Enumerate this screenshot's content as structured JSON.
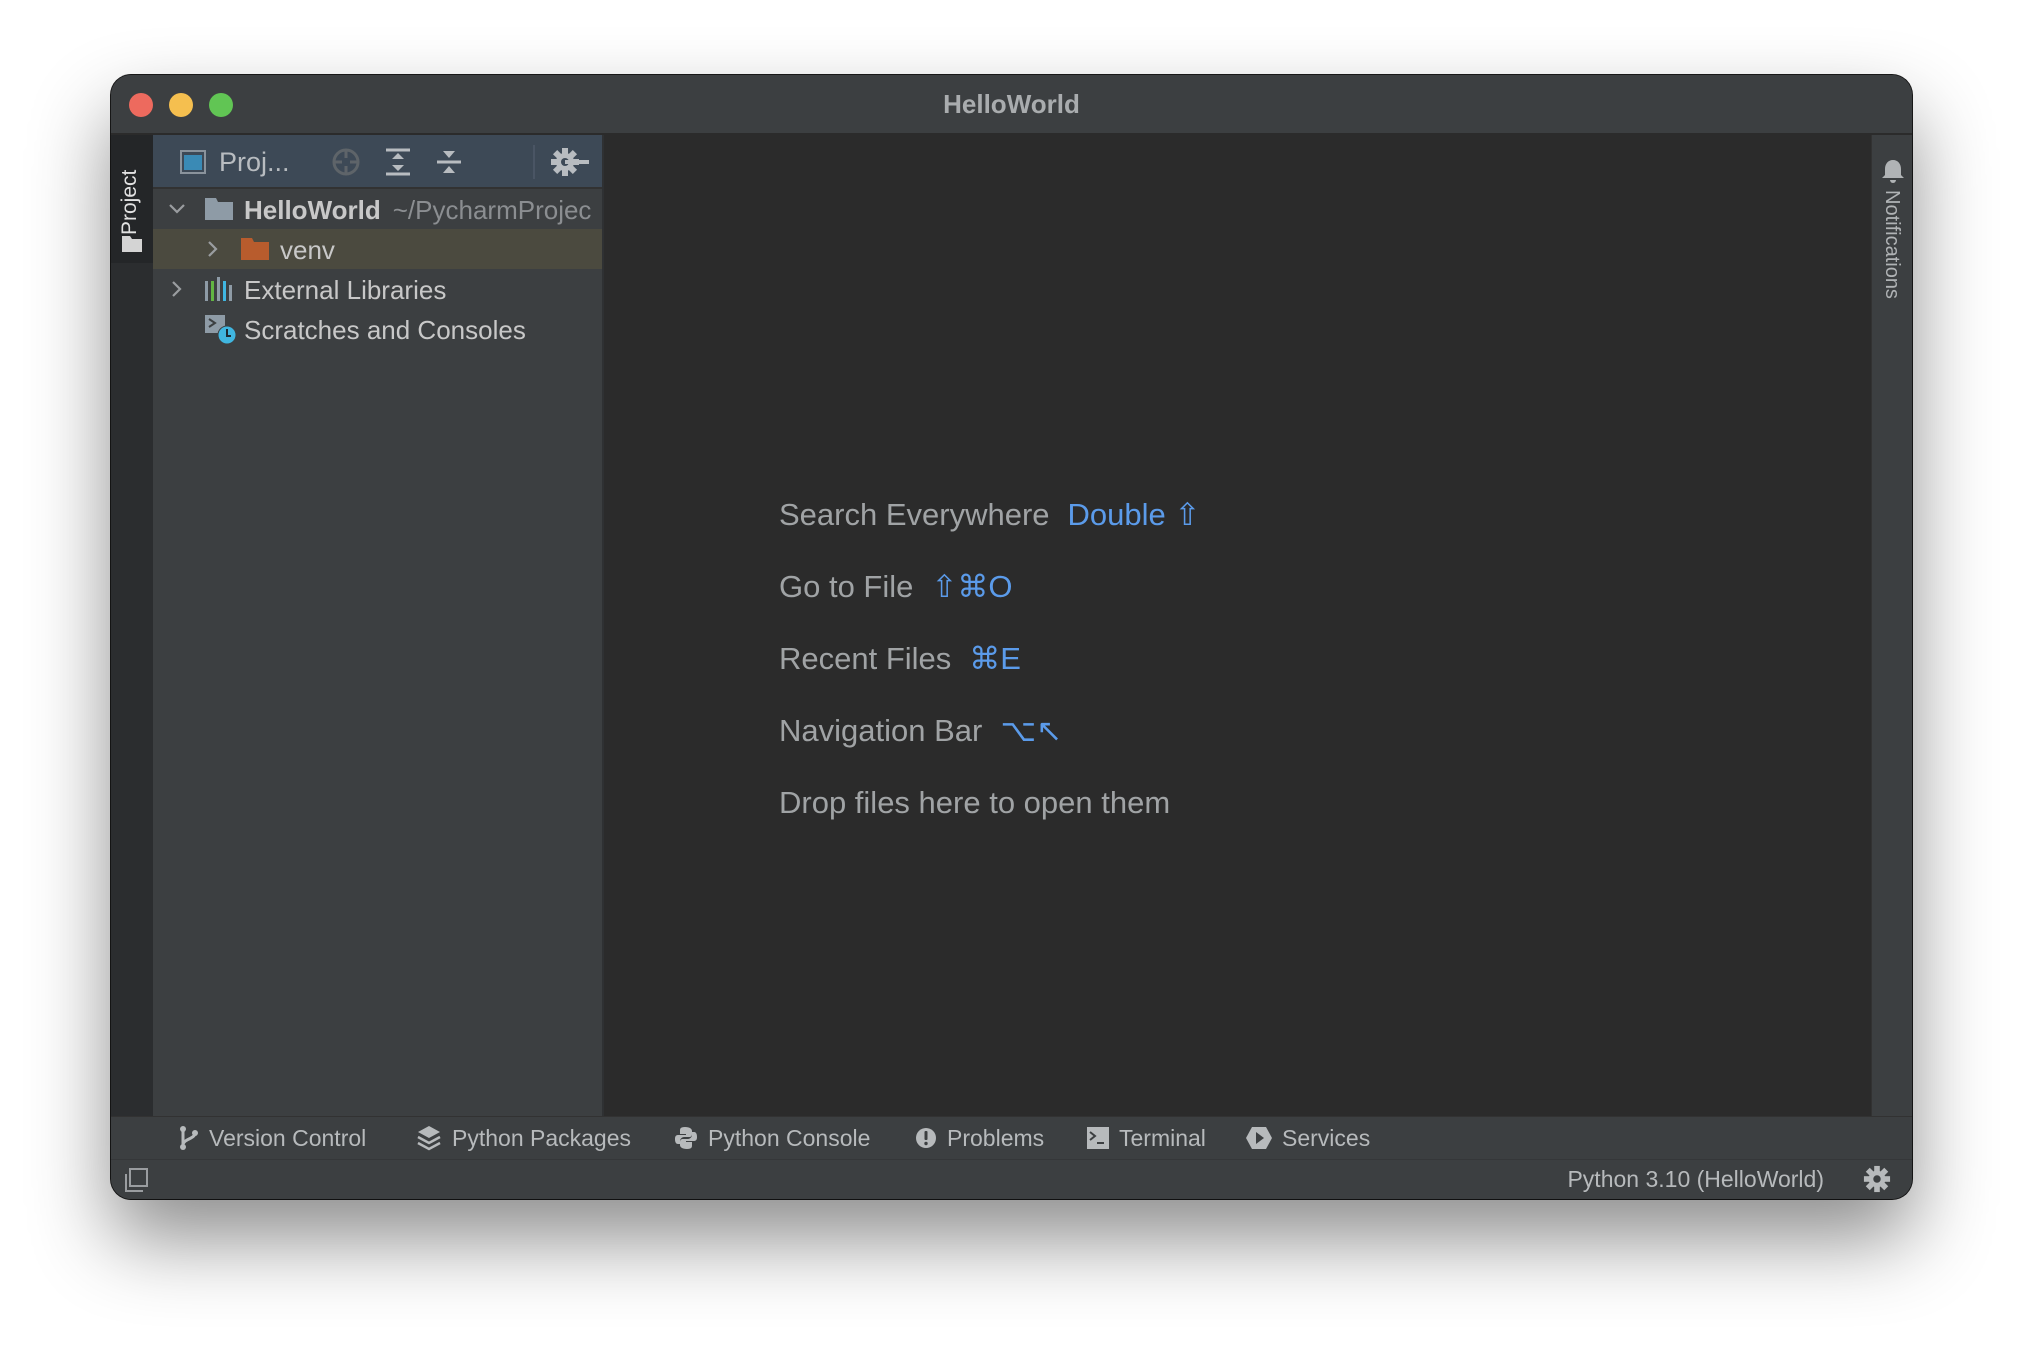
{
  "window": {
    "title": "HelloWorld",
    "traffic_lights": [
      "close",
      "minimize",
      "maximize"
    ]
  },
  "left_stripe": {
    "project_tab_label": "Project",
    "icon": "folder-icon"
  },
  "project_panel": {
    "header_title": "Proj...",
    "header_icons": [
      "project-view-icon",
      "locate-icon",
      "expand-all-icon",
      "collapse-all-icon",
      "gear-icon",
      "hide-icon"
    ],
    "tree": [
      {
        "label": "HelloWorld",
        "path": "~/PycharmProjec",
        "expanded": true,
        "icon": "folder-icon",
        "bold": true
      },
      {
        "label": "venv",
        "expanded": false,
        "icon": "excluded-folder-icon",
        "selected": true
      },
      {
        "label": "External Libraries",
        "expanded": false,
        "icon": "library-icon"
      },
      {
        "label": "Scratches and Consoles",
        "icon": "scratches-icon"
      }
    ]
  },
  "editor": {
    "hints": [
      {
        "label": "Search Everywhere",
        "shortcut": "Double ⇧"
      },
      {
        "label": "Go to File",
        "shortcut": "⇧⌘O"
      },
      {
        "label": "Recent Files",
        "shortcut": "⌘E"
      },
      {
        "label": "Navigation Bar",
        "shortcut": "⌥↖"
      },
      {
        "label": "Drop files here to open them",
        "shortcut": ""
      }
    ]
  },
  "right_stripe": {
    "notifications_label": "Notifications",
    "icon": "bell-icon"
  },
  "tool_windows": [
    {
      "label": "Version Control",
      "icon": "branch-icon"
    },
    {
      "label": "Python Packages",
      "icon": "layers-icon"
    },
    {
      "label": "Python Console",
      "icon": "python-icon"
    },
    {
      "label": "Problems",
      "icon": "problems-icon"
    },
    {
      "label": "Terminal",
      "icon": "terminal-icon"
    },
    {
      "label": "Services",
      "icon": "services-icon"
    }
  ],
  "status_bar": {
    "interpreter": "Python 3.10 (HelloWorld)",
    "icon_left": "layout-icon",
    "icon_right": "gear-icon"
  },
  "colors": {
    "accent_shortcut": "#5b9bea",
    "selection": "#4b4a3f",
    "panel_header": "#3d4956",
    "editor_bg": "#2b2b2b",
    "chrome_bg": "#3c3f41",
    "venv_folder": "#b85c2d"
  }
}
